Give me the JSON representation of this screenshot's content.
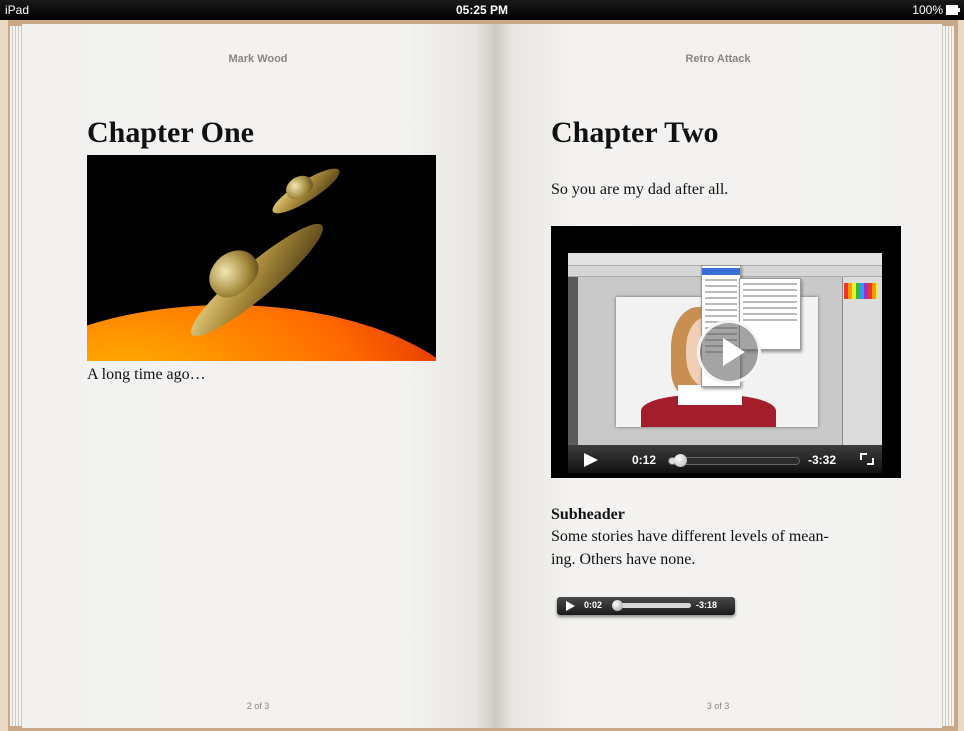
{
  "status_bar": {
    "device": "iPad",
    "time": "05:25 PM",
    "battery": "100%"
  },
  "left_page": {
    "running_head": "Mark Wood",
    "chapter_title": "Chapter One",
    "caption": "A long time ago…",
    "page_number": "2 of 3"
  },
  "right_page": {
    "running_head": "Retro Attack",
    "chapter_title": "Chapter Two",
    "intro": "So you are my dad after all.",
    "video": {
      "elapsed": "0:12",
      "remaining": "-3:32",
      "progress": 0.05
    },
    "subheader": "Subheader",
    "body_line1": "Some stories have different levels of mean-",
    "body_line2": "ing. Others have none.",
    "audio": {
      "elapsed": "0:02",
      "remaining": "-3:18",
      "progress": 0.01
    },
    "page_number": "3 of 3"
  },
  "colors": {
    "page": "#f4f3f1",
    "book_cover": "#c8a887",
    "running_head": "#8a8580"
  }
}
